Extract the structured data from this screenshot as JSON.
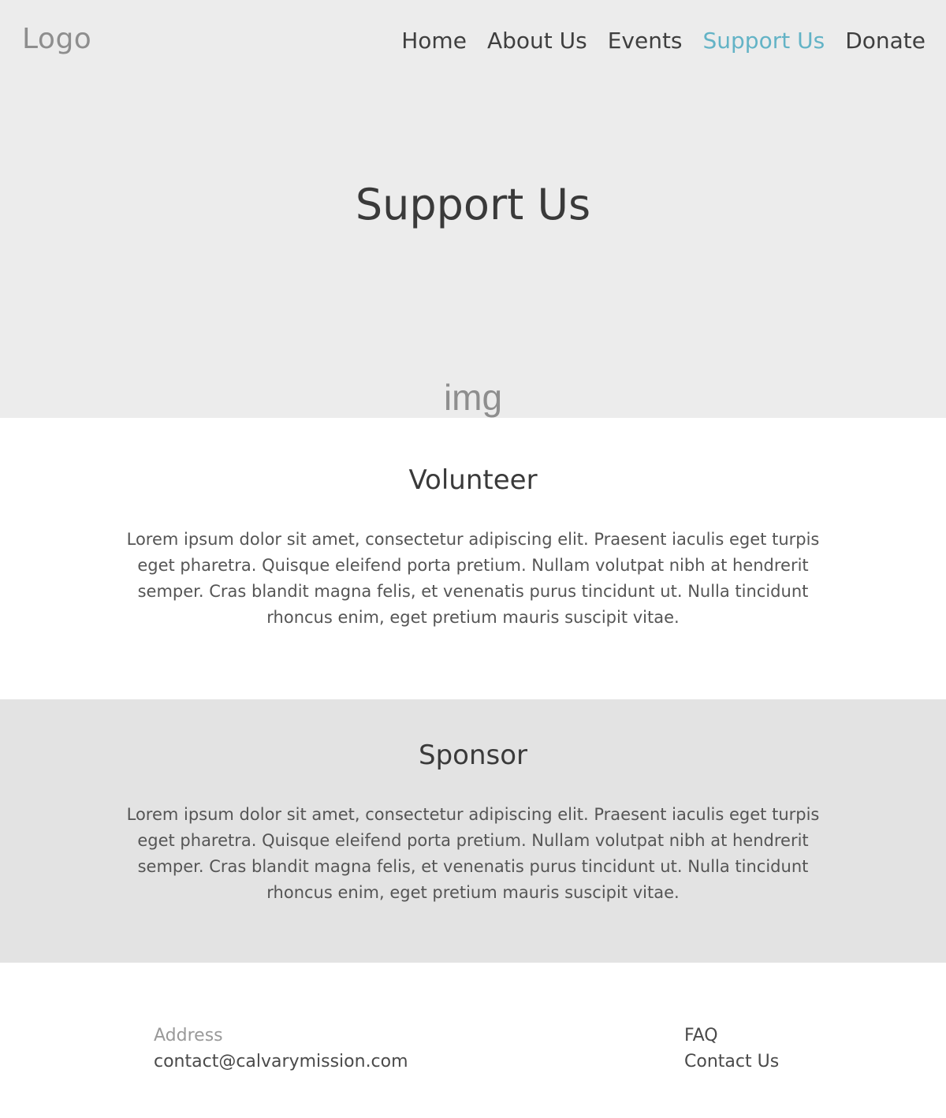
{
  "header": {
    "logo": "Logo",
    "nav": [
      {
        "label": "Home"
      },
      {
        "label": "About Us"
      },
      {
        "label": "Events"
      },
      {
        "label": "Support Us",
        "active": true
      },
      {
        "label": "Donate"
      }
    ]
  },
  "hero": {
    "title": "Support Us",
    "image_placeholder": "img"
  },
  "volunteer": {
    "heading": "Volunteer",
    "body": "Lorem ipsum dolor sit amet, consectetur adipiscing elit. Praesent iaculis eget turpis eget pharetra. Quisque eleifend porta pretium. Nullam volutpat nibh at hendrerit semper. Cras blandit magna felis, et venenatis purus tincidunt ut. Nulla tincidunt rhoncus enim, eget pretium mauris suscipit vitae."
  },
  "sponsor": {
    "heading": "Sponsor",
    "body": "Lorem ipsum dolor sit amet, consectetur adipiscing elit. Praesent iaculis eget turpis eget pharetra. Quisque eleifend porta pretium. Nullam volutpat nibh at hendrerit semper. Cras blandit magna felis, et venenatis purus tincidunt ut. Nulla tincidunt rhoncus enim, eget pretium mauris suscipit vitae."
  },
  "footer": {
    "address_label": "Address",
    "email": "contact@calvarymission.com",
    "faq": "FAQ",
    "contact": "Contact Us"
  },
  "colors": {
    "hero_bg": "#ececec",
    "sponsor_bg": "#e3e3e3",
    "active_nav": "#63b3c6",
    "muted_text": "#8e8e8e"
  }
}
